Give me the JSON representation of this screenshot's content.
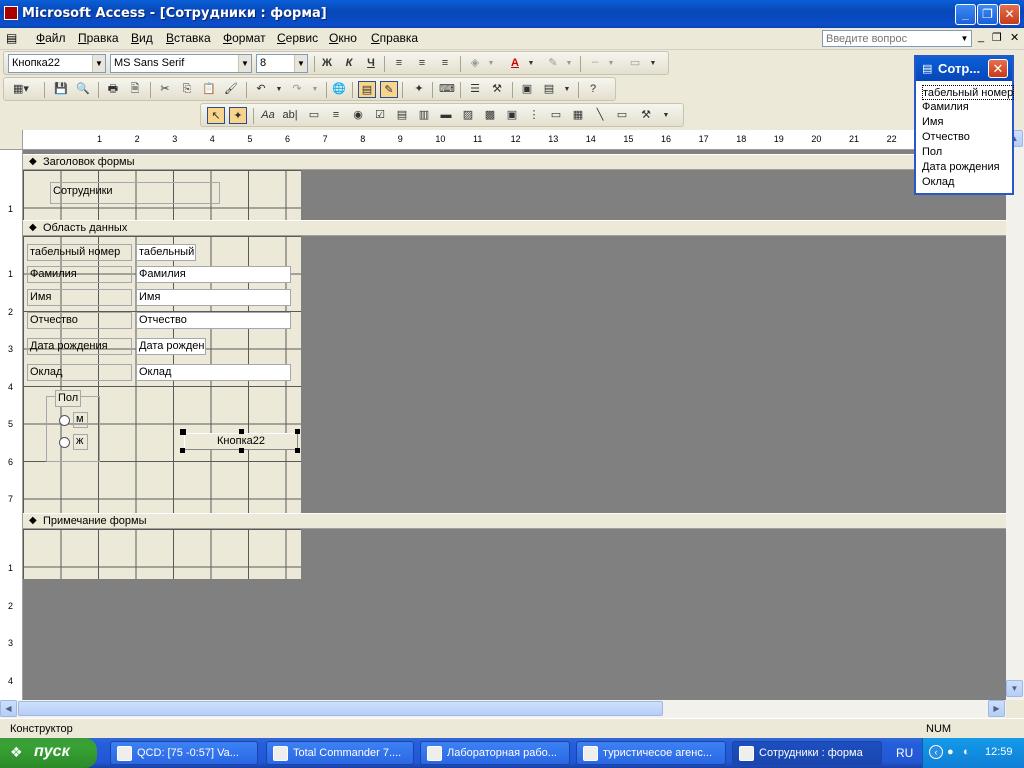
{
  "window": {
    "title": "Microsoft Access - [Сотрудники : форма]"
  },
  "menu": [
    "Файл",
    "Правка",
    "Вид",
    "Вставка",
    "Формат",
    "Сервис",
    "Окно",
    "Справка"
  ],
  "help_box": {
    "placeholder": "Введите вопрос"
  },
  "formatting": {
    "object": "Кнопка22",
    "font": "MS Sans Serif",
    "size": "8"
  },
  "formatting_buttons": {
    "bold": "Ж",
    "italic": "К",
    "underline": "Ч"
  },
  "sections": {
    "header": "Заголовок формы",
    "detail": "Область данных",
    "footer": "Примечание формы"
  },
  "form_header": {
    "title_label": "Сотрудники"
  },
  "detail_fields": [
    {
      "label": "табельный номер",
      "control": "табельный"
    },
    {
      "label": "Фамилия",
      "control": "Фамилия"
    },
    {
      "label": "Имя",
      "control": "Имя"
    },
    {
      "label": "Отчество",
      "control": "Отчество"
    },
    {
      "label": "Дата рождения",
      "control": "Дата рожден"
    },
    {
      "label": "Оклад",
      "control": "Оклад"
    }
  ],
  "option_group": {
    "label": "Пол",
    "options": [
      "м",
      "ж"
    ]
  },
  "button": {
    "caption": "Кнопка22"
  },
  "ruler_top": [
    "1",
    "2",
    "3",
    "4",
    "5",
    "6",
    "7",
    "8",
    "9",
    "10",
    "11",
    "12",
    "13",
    "14",
    "15",
    "16",
    "17",
    "18",
    "19",
    "20",
    "21",
    "22",
    "23"
  ],
  "ruler_left_header": [
    "1"
  ],
  "ruler_left_detail": [
    "1",
    "2",
    "3",
    "4",
    "5",
    "6",
    "7"
  ],
  "ruler_left_footer": [
    "1",
    "2",
    "3",
    "4"
  ],
  "field_list": {
    "title": "Сотр...",
    "items": [
      "табельный номер",
      "Фамилия",
      "Имя",
      "Отчество",
      "Пол",
      "Дата рождения",
      "Оклад"
    ]
  },
  "status": {
    "mode": "Конструктор",
    "num": "NUM"
  },
  "taskbar": {
    "start": "пуск",
    "tasks": [
      "QCD: [75 -0:57] Va...",
      "Total Commander 7....",
      "Лабораторная рабо...",
      "туристичесое агенс...",
      "Сотрудники : форма"
    ],
    "lang": "RU",
    "clock": "12:59"
  }
}
